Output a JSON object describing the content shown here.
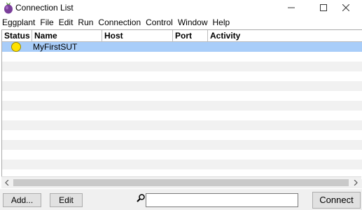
{
  "window": {
    "title": "Connection List",
    "controls": [
      "minimize",
      "maximize",
      "close"
    ]
  },
  "menubar": {
    "items": [
      "Eggplant",
      "File",
      "Edit",
      "Run",
      "Connection",
      "Control",
      "Window",
      "Help"
    ]
  },
  "table": {
    "columns": [
      "Status",
      "Name",
      "Host",
      "Port",
      "Activity"
    ],
    "rows": [
      {
        "status": "yellow",
        "name": "MyFirstSUT",
        "host": "",
        "port": "",
        "activity": "",
        "selected": true
      }
    ]
  },
  "footer": {
    "add_label": "Add...",
    "edit_label": "Edit",
    "search_value": "",
    "connect_label": "Connect"
  },
  "colors": {
    "selection": "#a8cdf9",
    "status_yellow": "#ffe200",
    "stripe": "#f1f1f1"
  },
  "icons": {
    "app": "eggplant-icon",
    "search": "search-icon",
    "scroll_left": "chevron-left-icon",
    "scroll_right": "chevron-right-icon"
  }
}
